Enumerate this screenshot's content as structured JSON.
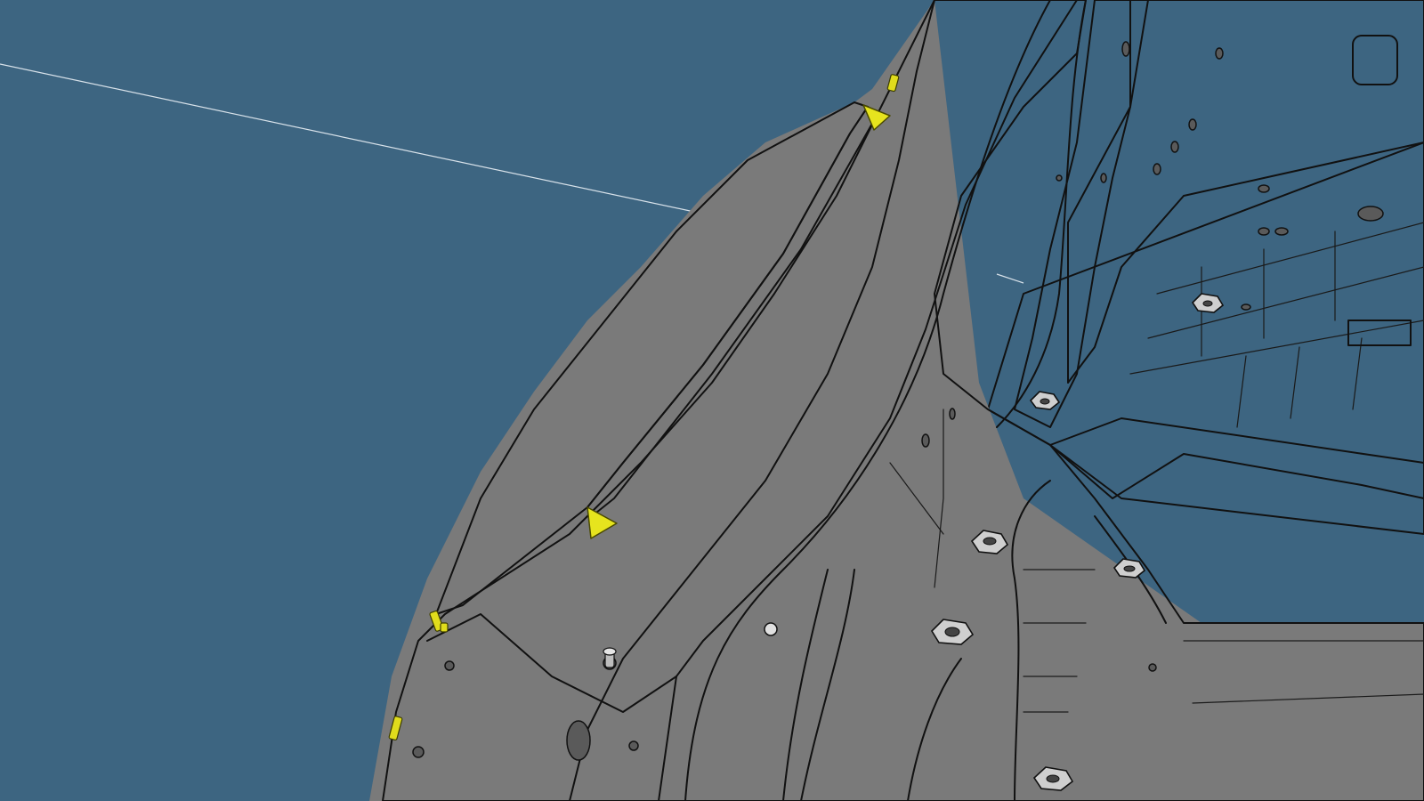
{
  "viewport": {
    "background_color": "#3d6581",
    "body_color": "#d9d9d9",
    "panel_color": "#7a7a7a",
    "marker_color": "#e6e41e"
  },
  "scene": {
    "description_label": "",
    "markers": [
      {
        "kind": "triangle-marker"
      },
      {
        "kind": "triangle-marker"
      },
      {
        "kind": "clip-marker"
      },
      {
        "kind": "clip-marker"
      },
      {
        "kind": "clip-marker"
      }
    ]
  }
}
